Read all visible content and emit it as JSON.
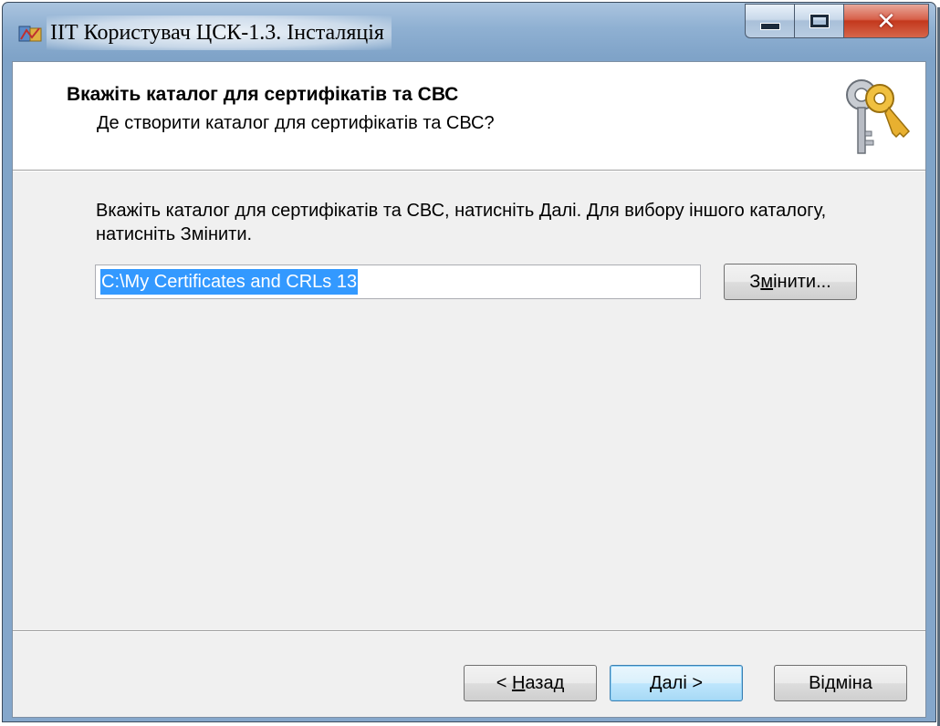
{
  "window": {
    "title": "ІІТ Користувач ЦСК-1.3. Інсталяція"
  },
  "header": {
    "title": "Вкажіть каталог для сертифікатів та СВС",
    "subtitle": "Де створити каталог для сертифікатів та СВС?"
  },
  "body": {
    "instructions": "Вкажіть каталог для сертифікатів та СВС, натисніть Далі. Для вибору іншого каталогу, натисніть Змінити.",
    "path_value": "C:\\My Certificates and CRLs 13",
    "change_button": {
      "before": "З",
      "accel": "м",
      "after": "інити..."
    }
  },
  "footer": {
    "back_button": {
      "before": "< ",
      "accel": "Н",
      "after": "азад"
    },
    "next_button": {
      "before": "",
      "accel": "Д",
      "after": "алі >"
    },
    "cancel_button": "Відміна"
  },
  "colors": {
    "selection": "#3399ff",
    "window_frame": "#8fb0d2",
    "close_button": "#c3381d"
  },
  "icons": [
    "installer-app-icon",
    "minimize-icon",
    "maximize-icon",
    "close-icon",
    "keys-icon"
  ]
}
